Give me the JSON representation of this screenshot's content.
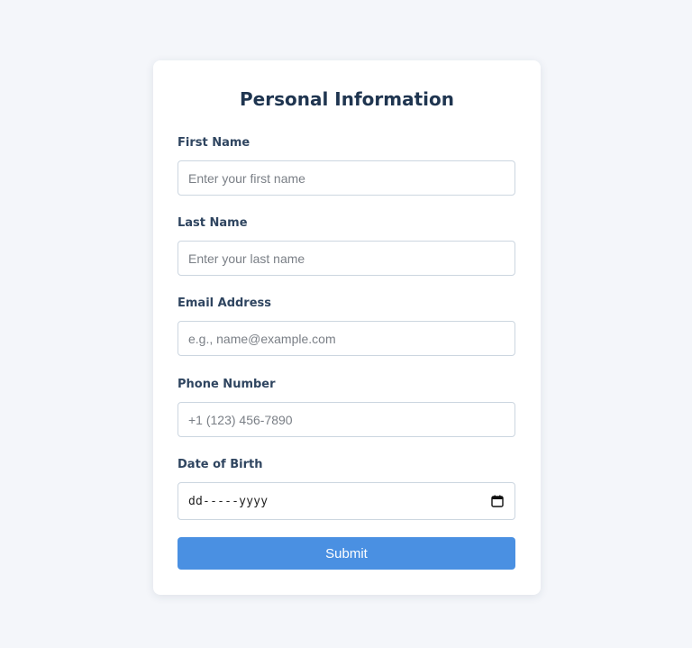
{
  "form": {
    "title": "Personal Information",
    "fields": {
      "first_name": {
        "label": "First Name",
        "placeholder": "Enter your first name"
      },
      "last_name": {
        "label": "Last Name",
        "placeholder": "Enter your last name"
      },
      "email": {
        "label": "Email Address",
        "placeholder": "e.g., name@example.com"
      },
      "phone": {
        "label": "Phone Number",
        "placeholder": "+1 (123) 456-7890"
      },
      "dob": {
        "label": "Date of Birth",
        "format": "dd-----yyyy",
        "icon": "calendar-icon"
      }
    },
    "submit_label": "Submit"
  },
  "colors": {
    "background": "#f4f6fa",
    "card": "#ffffff",
    "title": "#1f3550",
    "label": "#2f4560",
    "input_border": "#ccd6e0",
    "primary": "#4a90e2"
  }
}
